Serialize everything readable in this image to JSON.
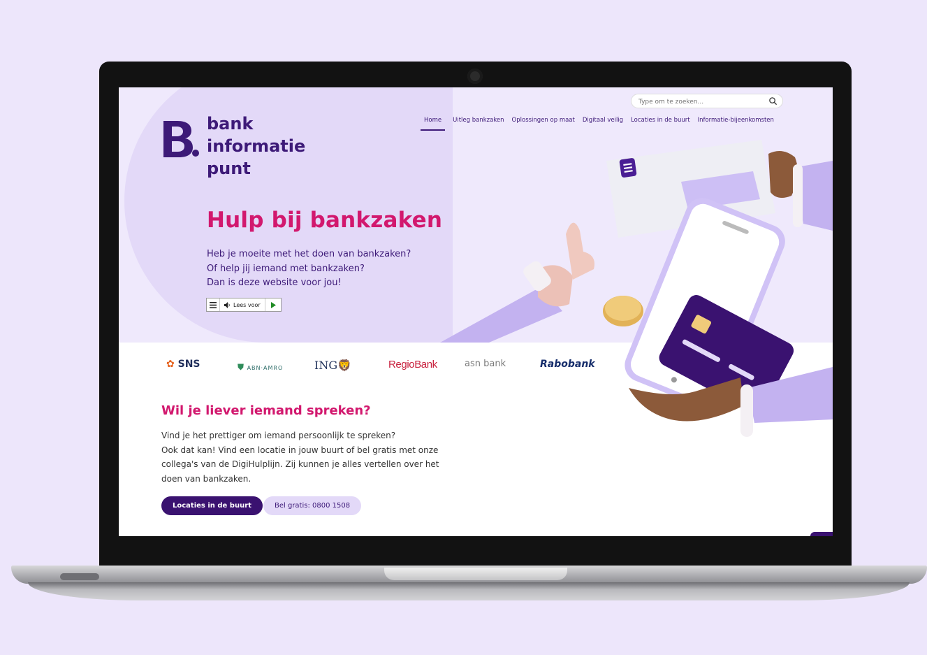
{
  "site": {
    "logo_line1": "bank",
    "logo_line2": "informatie",
    "logo_line3": "punt",
    "logo_mark": "B."
  },
  "search": {
    "placeholder": "Type om te zoeken..."
  },
  "nav": {
    "items": [
      {
        "label": "Home",
        "active": true
      },
      {
        "label": "Uitleg bankzaken"
      },
      {
        "label": "Oplossingen op maat"
      },
      {
        "label": "Digitaal veilig"
      },
      {
        "label": "Locaties in de buurt"
      },
      {
        "label": "Informatie-bijeenkomsten"
      }
    ]
  },
  "hero": {
    "title": "Hulp bij bankzaken",
    "line1": "Heb je moeite met het doen van bankzaken?",
    "line2": "Of help jij iemand met bankzaken?",
    "line3": "Dan is deze website voor jou!",
    "readspeaker_label": "Lees voor"
  },
  "banks": {
    "sns": "SNS",
    "abn": "ABN·AMRO",
    "ing": "ING",
    "regio": "RegioBank",
    "asn": "asn bank",
    "rabo": "Rabobank"
  },
  "contact": {
    "title": "Wil je liever iemand spreken?",
    "line1": "Vind je het prettiger om iemand persoonlijk te spreken?",
    "line2": "Ook dat kan! Vind een locatie in jouw buurt of bel gratis met onze",
    "line3": "collega's van de DigiHulplijn. Zij kunnen je alles vertellen over het",
    "line4": "doen van bankzaken.",
    "primary_button": "Locaties in de buurt",
    "secondary_button": "Bel gratis: 0800 1508"
  },
  "colors": {
    "brand_purple": "#3d1a78",
    "accent_pink": "#d2186e",
    "hero_lilac": "#e3d9f8",
    "page_background": "#ede6fb"
  },
  "icons": [
    "search-icon",
    "menu-icon",
    "speaker-icon",
    "play-icon",
    "envelope-icon",
    "phone-icon",
    "credit-card-icon",
    "coin-icon"
  ]
}
